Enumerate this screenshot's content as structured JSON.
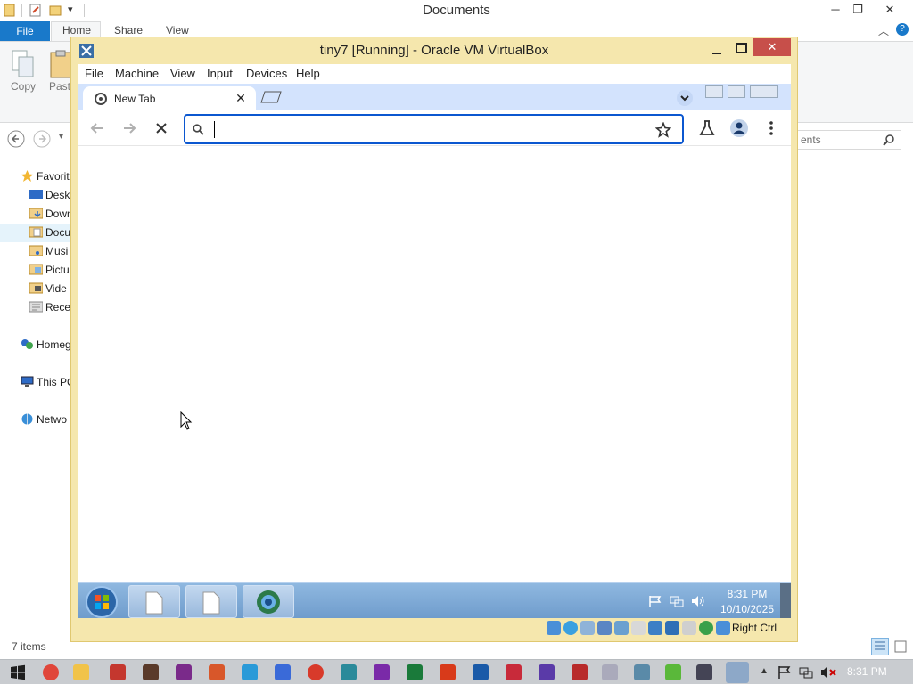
{
  "explorer": {
    "title": "Documents",
    "ribbon_tabs": {
      "file": "File",
      "home": "Home",
      "share": "Share",
      "view": "View"
    },
    "ribbon_buttons": {
      "copy": "Copy",
      "paste": "Paste"
    },
    "search_placeholder": "ents",
    "nav": [
      {
        "label": "Favorites",
        "icon": "star-icon"
      },
      {
        "label": "Desktop",
        "icon": "desktop-icon"
      },
      {
        "label": "Downloads",
        "icon": "folder-icon"
      },
      {
        "label": "Documents",
        "icon": "folder-icon"
      },
      {
        "label": "Music",
        "icon": "folder-icon"
      },
      {
        "label": "Pictures",
        "icon": "folder-icon"
      },
      {
        "label": "Videos",
        "icon": "folder-icon"
      },
      {
        "label": "Recent places",
        "icon": "recent-icon"
      },
      {
        "label": "Homegroup",
        "icon": "homegroup-icon"
      },
      {
        "label": "This PC",
        "icon": "computer-icon"
      },
      {
        "label": "Network",
        "icon": "network-icon"
      }
    ],
    "nav_visible": [
      "Favorite",
      "Deskt",
      "Down",
      "Docu",
      "Musi",
      "Pictu",
      "Vide",
      "Recen",
      "Homeg",
      "This PC",
      "Netwo"
    ],
    "items_count": "7 items"
  },
  "vbox": {
    "title": "tiny7 [Running] - Oracle VM VirtualBox",
    "menu": [
      "File",
      "Machine",
      "View",
      "Input",
      "Devices",
      "Help"
    ],
    "host_key": "Right Ctrl"
  },
  "guest": {
    "chrome": {
      "tab_title": "New Tab",
      "omnibox_value": ""
    },
    "taskbar": {
      "time": "8:31 PM",
      "date": "10/10/2025"
    }
  },
  "host_taskbar": {
    "clock": "8:31 PM"
  },
  "colors": {
    "vbox_frame": "#f5e7ad",
    "vbox_close": "#c74f4a",
    "chrome_tabstrip": "#d3e3fd",
    "omnibox_border": "#0b57d0",
    "file_tab": "#1979ca",
    "host_taskbar": "#c9ccd0"
  }
}
